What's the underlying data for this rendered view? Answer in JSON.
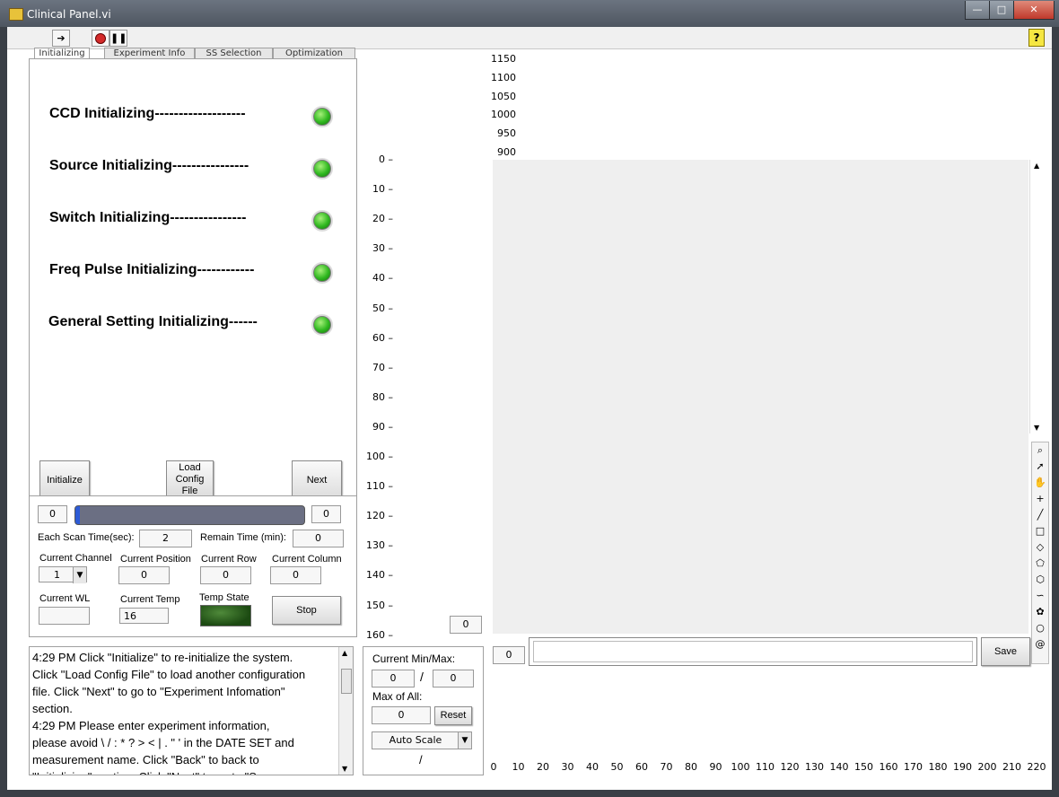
{
  "window": {
    "title": "Clinical Panel.vi",
    "min": "—",
    "max": "□",
    "close": "✕"
  },
  "toolbar": {
    "run_icon": "run-arrow-icon",
    "abort_icon": "abort-icon",
    "pause_icon": "pause-icon",
    "help_label": "?"
  },
  "tabs": [
    {
      "label": "Initializing"
    },
    {
      "label": "Experiment Info"
    },
    {
      "label": "SS Selection"
    },
    {
      "label": "Optimization"
    }
  ],
  "init_items": [
    {
      "label": "CCD Initializing-------------------"
    },
    {
      "label": "Source Initializing----------------"
    },
    {
      "label": "Switch Initializing----------------"
    },
    {
      "label": "Freq Pulse Initializing------------"
    },
    {
      "label": "General Setting Initializing------"
    }
  ],
  "buttons": {
    "initialize": "Initialize",
    "load_config_1": "Load",
    "load_config_2": "Config",
    "load_config_3": "File",
    "next": "Next",
    "stop": "Stop",
    "save": "Save",
    "reset": "Reset"
  },
  "progress": {
    "left_value": "0",
    "right_value": "0",
    "fraction": 0.02
  },
  "status": {
    "each_scan_label": "Each Scan Time(sec):",
    "each_scan_value": "2",
    "remain_label": "Remain Time (min):",
    "remain_value": "0",
    "channel_label": "Current Channel",
    "channel_value": "1",
    "position_label": "Current Position",
    "position_value": "0",
    "row_label": "Current Row",
    "row_value": "0",
    "column_label": "Current Column",
    "column_value": "0",
    "wl_label": "Current WL",
    "wl_value": "",
    "temp_label": "Current Temp",
    "temp_value": "16",
    "temp_state_label": "Temp State"
  },
  "log_lines": [
    "4:29 PM    Click \"Initialize\" to re-initialize the system.",
    "Click \"Load Config File\" to load another configuration",
    "file. Click \"Next\" to go to \"Experiment Infomation\"",
    "section.",
    "4:29 PM    Please enter experiment information,",
    "please avoid \\ / : * ? > < | . \" ' in the DATE SET and",
    "measurement name. Click \"Back\" to back to",
    "\"Initializing\" section. Click \"Next\" to go to \"Source"
  ],
  "graph": {
    "y_ticks": [
      "0",
      "10",
      "20",
      "30",
      "40",
      "50",
      "60",
      "70",
      "80",
      "90",
      "100",
      "110",
      "120",
      "130",
      "140",
      "150",
      "160"
    ],
    "top_ticks": [
      "1150",
      "1100",
      "1050",
      "1000",
      "950",
      "900"
    ],
    "x_ticks": [
      "0",
      "10",
      "20",
      "30",
      "40",
      "50",
      "60",
      "70",
      "80",
      "90",
      "100",
      "110",
      "120",
      "130",
      "140",
      "150",
      "160",
      "170",
      "180",
      "190",
      "200",
      "210",
      "220"
    ],
    "cursor_value": "0",
    "index_value": "0",
    "path_value": ""
  },
  "minmax": {
    "current_label": "Current Min/Max:",
    "min_value": "0",
    "slash": "/",
    "max_value": "0",
    "max_all_label": "Max of All:",
    "max_all_value": "0",
    "scale_value": "Auto Scale",
    "bottom_slash": "/"
  },
  "colors": {
    "led_green": "#2fb81f",
    "progress_fill": "#6b6f83",
    "progress_marker": "#2d5bd6",
    "temp_state": "#1c4a12"
  }
}
